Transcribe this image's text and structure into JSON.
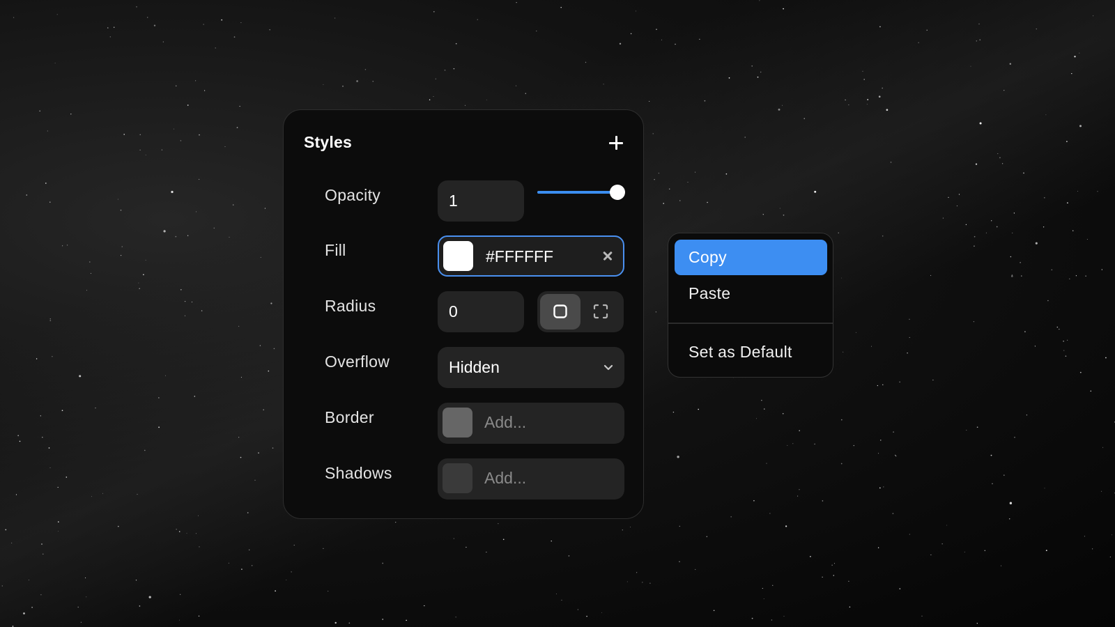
{
  "panel": {
    "title": "Styles",
    "opacity": {
      "label": "Opacity",
      "value": "1",
      "slider_fraction": 1.0,
      "accent": "#3b8ef0"
    },
    "fill": {
      "label": "Fill",
      "value": "#FFFFFF",
      "swatch_color": "#ffffff",
      "focus_color": "#4a90f0"
    },
    "radius": {
      "label": "Radius",
      "value": "0",
      "mode_selected": "uniform"
    },
    "overflow": {
      "label": "Overflow",
      "value": "Hidden"
    },
    "border": {
      "label": "Border",
      "placeholder": "Add...",
      "swatch_color": "#666666"
    },
    "shadows": {
      "label": "Shadows",
      "placeholder": "Add...",
      "swatch_color": "#3a3a3a"
    }
  },
  "context_menu": {
    "items": [
      {
        "label": "Copy",
        "active": true
      },
      {
        "label": "Paste",
        "active": false
      },
      {
        "label": "Set as Default",
        "active": false
      }
    ],
    "highlight_color": "#3d8ef2"
  }
}
